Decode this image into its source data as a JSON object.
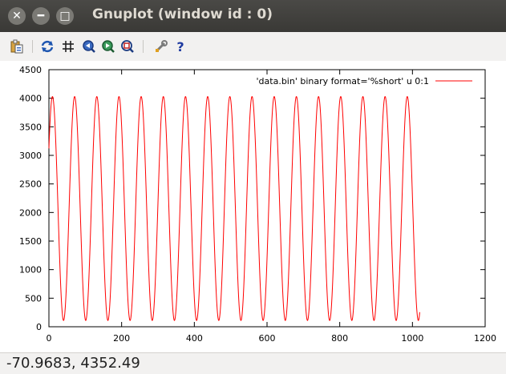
{
  "window": {
    "title": "Gnuplot (window id : 0)"
  },
  "toolbar": {
    "buttons": [
      {
        "name": "copy-clipboard-icon"
      },
      {
        "name": "replot-icon"
      },
      {
        "name": "grid-icon"
      },
      {
        "name": "zoom-previous-icon"
      },
      {
        "name": "zoom-next-icon"
      },
      {
        "name": "autoscale-icon"
      },
      {
        "name": "settings-icon"
      },
      {
        "name": "help-icon"
      }
    ]
  },
  "status": {
    "coordinates": "-70.9683,  4352.49"
  },
  "chart_data": {
    "type": "line",
    "series": [
      {
        "name": "'data.bin' binary format='%short' u 0:1",
        "color": "#ff0000",
        "function": "2050 + 1950*sin(2*pi*(x + 5.5)/61)",
        "x_range": [
          0,
          1020
        ],
        "start_value": 3500,
        "peak_value": 4020,
        "trough_value": 100,
        "period": 61
      }
    ],
    "xlim": [
      0,
      1200
    ],
    "ylim": [
      0,
      4500
    ],
    "xticks": [
      0,
      200,
      400,
      600,
      800,
      1000,
      1200
    ],
    "yticks": [
      0,
      500,
      1000,
      1500,
      2000,
      2500,
      3000,
      3500,
      4000,
      4500
    ],
    "legend": "top-right",
    "grid": false
  },
  "colors": {
    "titlebar": "#3c3b37",
    "line": "#ff0000",
    "title_text": "#dfdbd2"
  }
}
